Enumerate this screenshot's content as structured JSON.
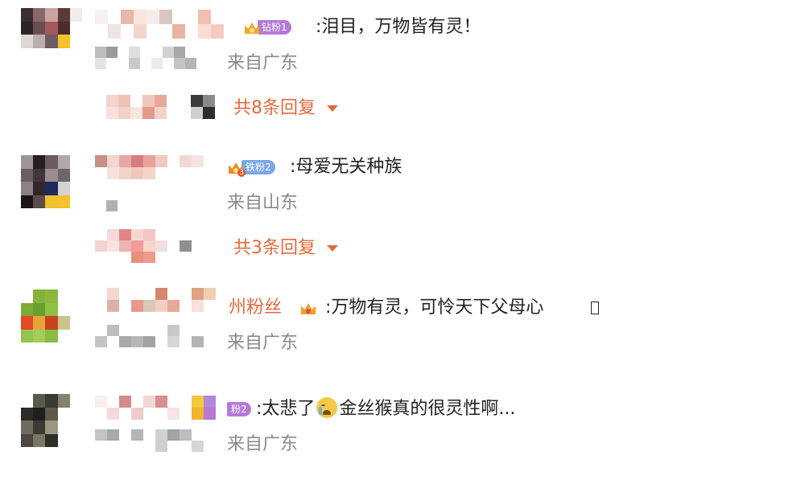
{
  "comments": [
    {
      "badge_label": "钻粉1",
      "badge_color": "#b47ad8",
      "crown_number": "",
      "text": ":泪目，万物皆有灵！",
      "location": "来自广东",
      "replies_label": "共8条回复"
    },
    {
      "badge_label": "铁粉2",
      "badge_color": "#7aa7e6",
      "crown_number": "3",
      "text": ":母爱无关种族",
      "location": "来自山东",
      "replies_label": "共3条回复"
    },
    {
      "username_partial": "州粉丝",
      "text": ":万物有灵，可怜天下父母心",
      "location": "来自广东"
    },
    {
      "badge_label": "粉2",
      "badge_color": "#b47ad8",
      "text_before_emoji": ":太悲了",
      "emoji_icon": "crying-face-icon",
      "text_after_emoji": "金丝猴真的很灵性啊...",
      "location": "来自广东"
    }
  ]
}
